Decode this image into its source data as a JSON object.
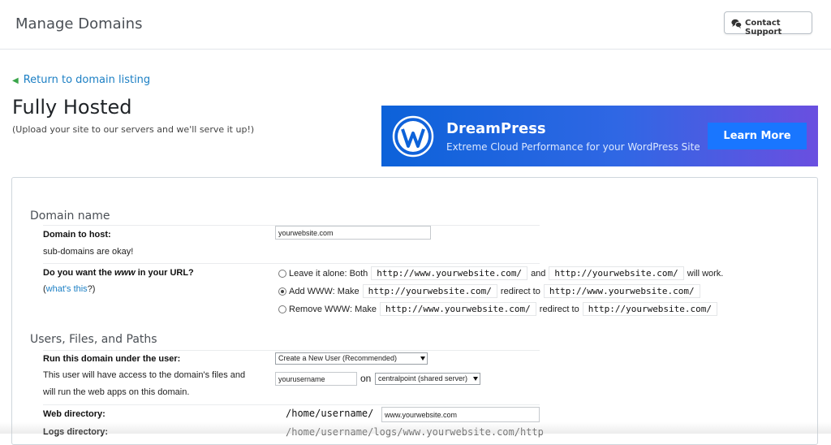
{
  "header": {
    "title": "Manage Domains",
    "support_label": "Contact Support"
  },
  "nav": {
    "back_link": "Return to domain listing"
  },
  "page": {
    "heading": "Fully Hosted",
    "subheading": "(Upload your site to our servers and we'll serve it up!)"
  },
  "banner": {
    "title": "DreamPress",
    "subtitle": "Extreme Cloud Performance for your WordPress Site",
    "button": "Learn More"
  },
  "domain_section": {
    "title": "Domain name",
    "host_label": "Domain to host:",
    "host_hint": "sub-domains are okay!",
    "host_value": "yourwebsite.com",
    "www_label_pre": "Do you want the ",
    "www_label_em": "www",
    "www_label_post": " in your URL?",
    "whats_this_pre": "(",
    "whats_this": "what's this",
    "whats_this_post": "?)",
    "options": [
      {
        "selected": false,
        "prefix": "Leave it alone: Both",
        "code1": "http://www.yourwebsite.com/",
        "mid": "and",
        "code2": "http://yourwebsite.com/",
        "suffix": "will work."
      },
      {
        "selected": true,
        "prefix": "Add WWW: Make",
        "code1": "http://yourwebsite.com/",
        "mid": "redirect to",
        "code2": "http://www.yourwebsite.com/",
        "suffix": ""
      },
      {
        "selected": false,
        "prefix": "Remove WWW: Make",
        "code1": "http://www.yourwebsite.com/",
        "mid": "redirect to",
        "code2": "http://yourwebsite.com/",
        "suffix": ""
      }
    ]
  },
  "users_section": {
    "title": "Users, Files, and Paths",
    "run_label": "Run this domain under the user:",
    "run_hint1": "This user will have access to the domain's files and",
    "run_hint2": "will run the web apps on this domain.",
    "user_select": "Create a New User (Recommended)",
    "username_value": "yourusername",
    "on_label": "on",
    "server_select": "centralpoint (shared server)",
    "web_dir_label": "Web directory:",
    "web_dir_prefix": "/home/username/",
    "web_dir_value": "www.yourwebsite.com",
    "logs_label": "Logs directory:",
    "logs_value": "/home/username/logs/www.yourwebsite.com/http"
  },
  "colors": {
    "link": "#1b7fc4",
    "banner_start": "#0c62d9",
    "banner_end": "#6a4fe0",
    "banner_button": "#1976ff"
  }
}
